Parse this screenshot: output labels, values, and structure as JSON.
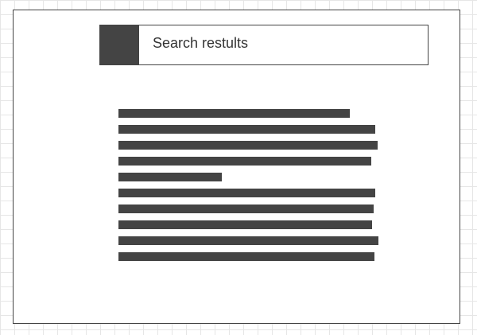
{
  "header": {
    "title": "Search restults"
  },
  "colors": {
    "ink": "#444444",
    "grid": "#e6e6e6",
    "paper": "#ffffff"
  },
  "icons": {
    "logo": "placeholder-block"
  },
  "results": {
    "line_count": 10
  }
}
